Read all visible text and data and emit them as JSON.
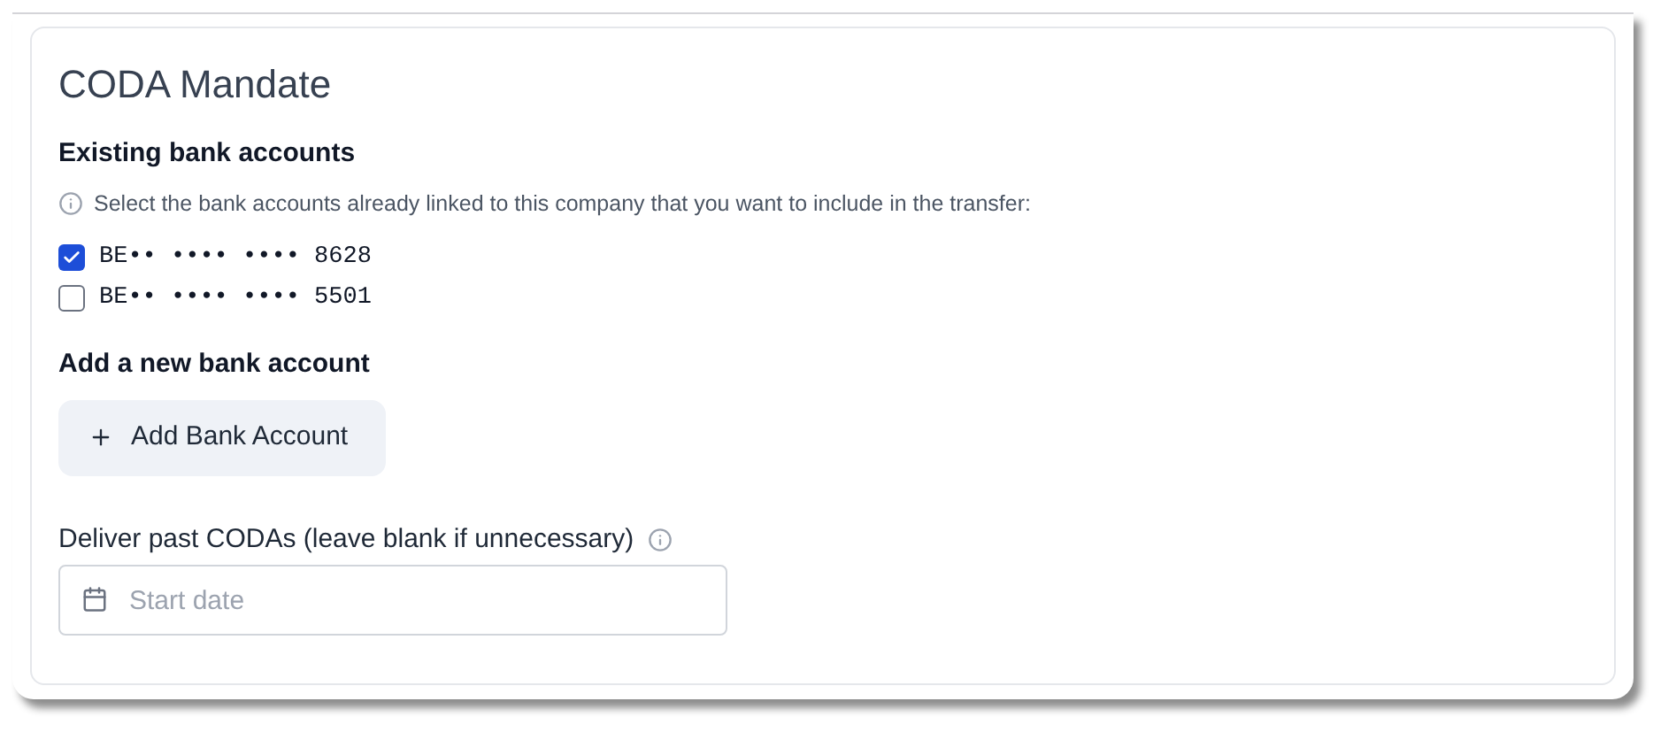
{
  "card": {
    "title": "CODA Mandate",
    "existing": {
      "heading": "Existing bank accounts",
      "hint": "Select the bank accounts already linked to this company that you want to include in the transfer:",
      "accounts": [
        {
          "label": "BE•• •••• •••• 8628",
          "checked": true
        },
        {
          "label": "BE•• •••• •••• 5501",
          "checked": false
        }
      ]
    },
    "add": {
      "heading": "Add a new bank account",
      "button": "Add Bank Account"
    },
    "past": {
      "label": "Deliver past CODAs (leave blank if unnecessary)",
      "placeholder": "Start date"
    }
  }
}
